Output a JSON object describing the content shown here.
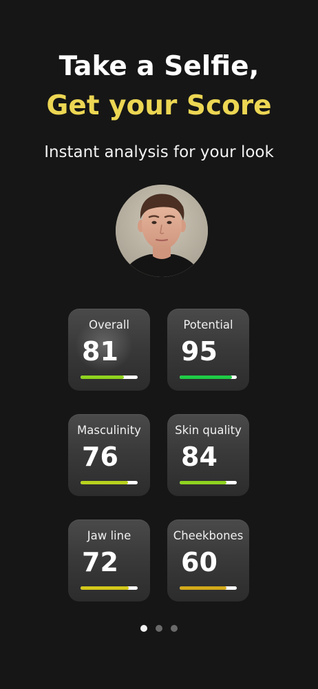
{
  "header": {
    "title_line1": "Take a Selfie,",
    "title_line2": "Get your Score",
    "subtitle": "Instant analysis for your look"
  },
  "colors": {
    "background": "#161616",
    "accent_yellow": "#ecd653",
    "card": "#3a3a3a"
  },
  "metrics": [
    {
      "label": "Overall",
      "score": "81",
      "fill": 0.76,
      "color": "#8fd31f"
    },
    {
      "label": "Potential",
      "score": "95",
      "fill": 0.92,
      "color": "#1fcc45"
    },
    {
      "label": "Masculinity",
      "score": "76",
      "fill": 0.83,
      "color": "#b8d21e"
    },
    {
      "label": "Skin quality",
      "score": "84",
      "fill": 0.82,
      "color": "#8fd31f"
    },
    {
      "label": "Jaw line",
      "score": "72",
      "fill": 0.84,
      "color": "#d3c81a"
    },
    {
      "label": "Cheekbones",
      "score": "60",
      "fill": 0.82,
      "color": "#d3aa1a"
    }
  ],
  "pagination": {
    "count": 3,
    "active": 1
  }
}
